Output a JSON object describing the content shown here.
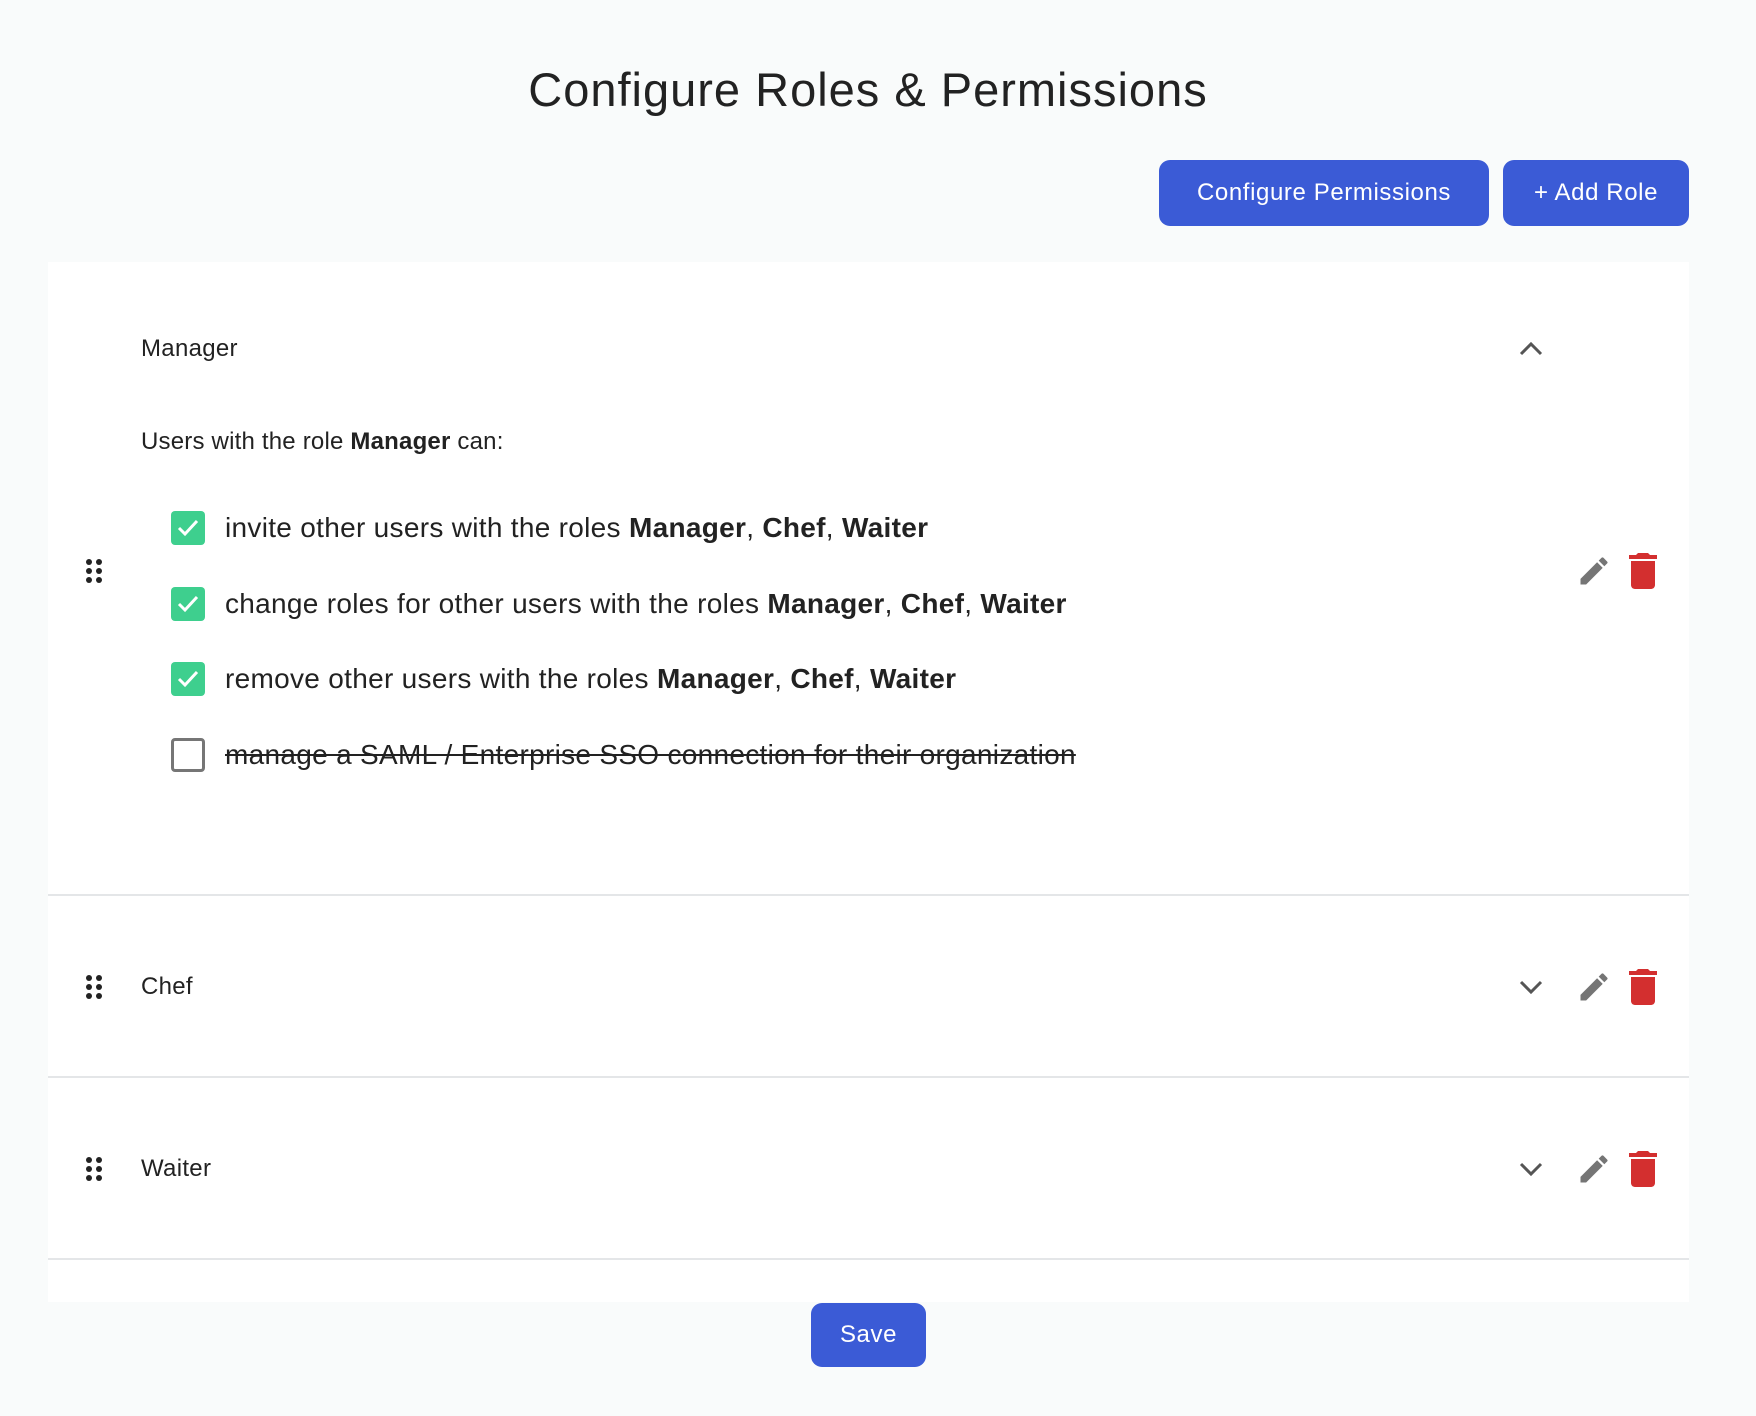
{
  "header": {
    "title": "Configure Roles & Permissions",
    "configure_permissions_label": "Configure Permissions",
    "add_role_label": "+ Add Role"
  },
  "roles": [
    {
      "name": "Manager",
      "expanded": true,
      "intro_prefix": "Users with the role",
      "intro_role": "Manager",
      "intro_suffix": "can:",
      "permissions": [
        {
          "checked": true,
          "text": "invite other users with the roles",
          "roles": [
            "Manager",
            "Chef",
            "Waiter"
          ]
        },
        {
          "checked": true,
          "text": "change roles for other users with the roles",
          "roles": [
            "Manager",
            "Chef",
            "Waiter"
          ]
        },
        {
          "checked": true,
          "text": "remove other users with the roles",
          "roles": [
            "Manager",
            "Chef",
            "Waiter"
          ]
        },
        {
          "checked": false,
          "text": "manage a SAML / Enterprise SSO connection for their organization",
          "roles": []
        }
      ]
    },
    {
      "name": "Chef",
      "expanded": false
    },
    {
      "name": "Waiter",
      "expanded": false
    }
  ],
  "footer": {
    "save_label": "Save"
  },
  "colors": {
    "primary": "#3b5bd6",
    "checkbox_checked": "#3ecf8e",
    "delete": "#d32f2f",
    "icon_gray": "#757575"
  },
  "icons": [
    "drag-handle-icon",
    "chevron-up-icon",
    "chevron-down-icon",
    "edit-icon",
    "trash-icon",
    "check-icon"
  ]
}
